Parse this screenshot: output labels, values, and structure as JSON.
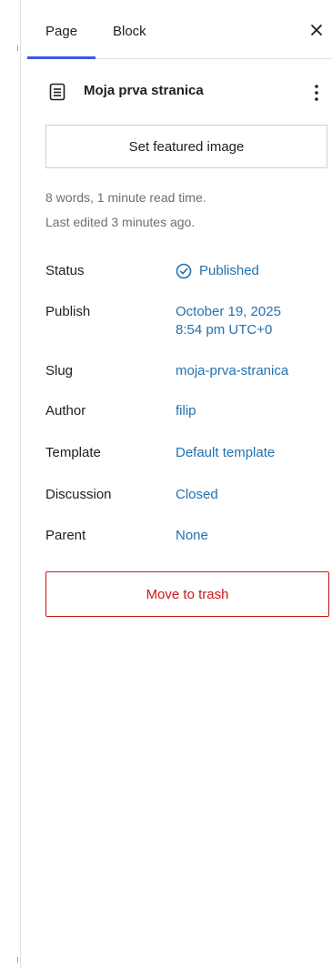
{
  "tabs": {
    "page_label": "Page",
    "block_label": "Block",
    "active": "Page"
  },
  "icons": {
    "close": "close-icon",
    "document": "page-document-icon",
    "more": "more-options-icon",
    "status": "check-circle-icon"
  },
  "page": {
    "title": "Moja prva stranica"
  },
  "featured_image": {
    "button_label": "Set featured image"
  },
  "meta": {
    "words": "8 words, 1 minute read time.",
    "last_edited": "Last edited 3 minutes ago."
  },
  "properties": {
    "status": {
      "label": "Status",
      "value": "Published"
    },
    "publish": {
      "label": "Publish",
      "date": "October 19, 2025",
      "time": "8:54 pm UTC+0"
    },
    "slug": {
      "label": "Slug",
      "value": "moja-prva-stranica"
    },
    "author": {
      "label": "Author",
      "value": "filip"
    },
    "template": {
      "label": "Template",
      "value": "Default template"
    },
    "discussion": {
      "label": "Discussion",
      "value": "Closed"
    },
    "parent": {
      "label": "Parent",
      "value": "None"
    }
  },
  "actions": {
    "trash_label": "Move to trash"
  },
  "colors": {
    "accent": "#3858e9",
    "link": "#2271b1",
    "danger": "#cc1818",
    "muted": "#6e6e6e"
  }
}
